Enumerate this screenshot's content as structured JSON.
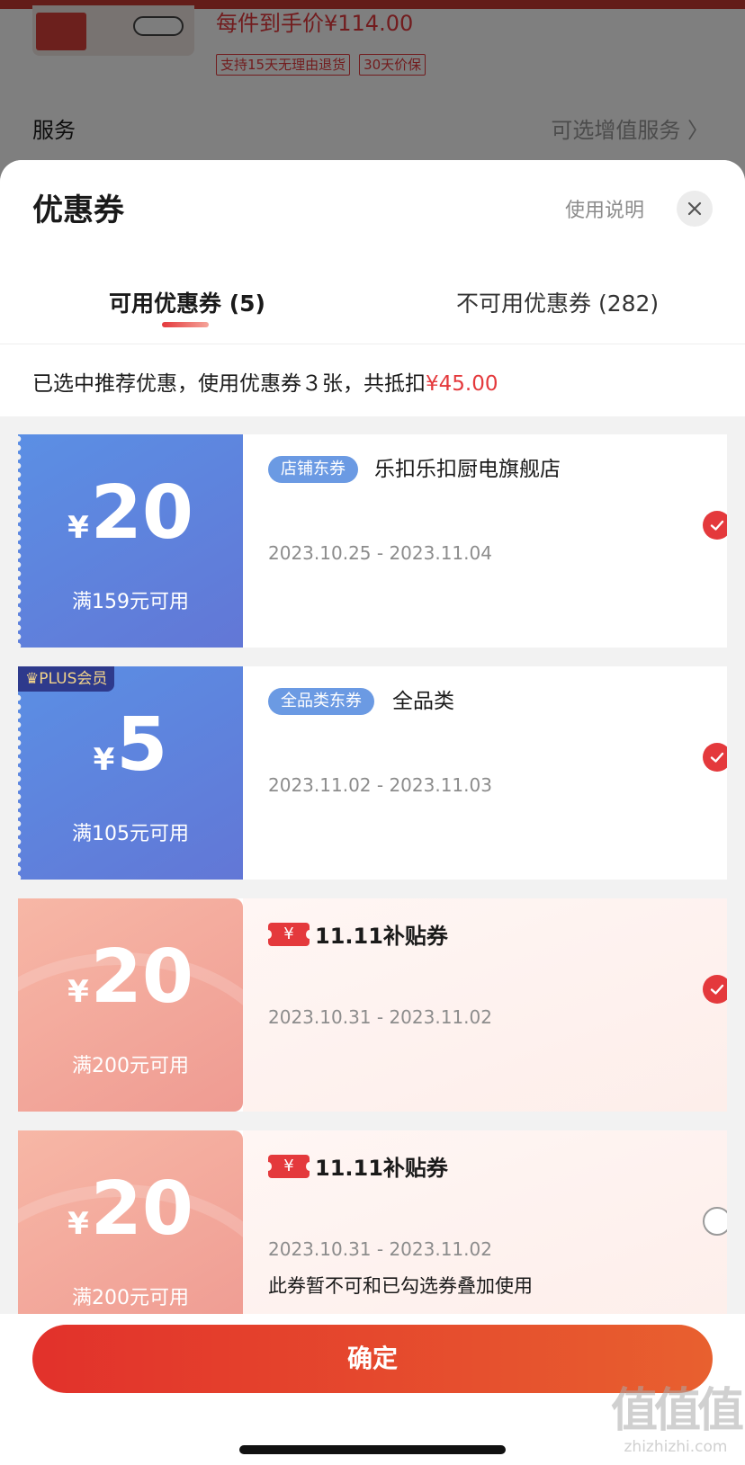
{
  "background": {
    "price_text": "每件到手价¥114.00",
    "tags": [
      "支持15天无理由退货",
      "30天价保"
    ],
    "service_label": "服务",
    "service_value": "可选增值服务 〉"
  },
  "sheet": {
    "title": "优惠券",
    "help_label": "使用说明",
    "close_icon": "close-icon"
  },
  "tabs": [
    {
      "label": "可用优惠券 (5)",
      "active": true
    },
    {
      "label": "不可用优惠券 (282)",
      "active": false
    }
  ],
  "summary": {
    "text": "已选中推荐优惠，使用优惠券３张，共抵扣",
    "amount": "¥45.00"
  },
  "coupons": [
    {
      "style": "blue",
      "currency": "¥",
      "amount": "20",
      "threshold": "满159元可用",
      "type_tag": "店铺东券",
      "scope": "乐扣乐扣厨电旗舰店",
      "validity": "2023.10.25 - 2023.11.04",
      "selected": true
    },
    {
      "style": "blue",
      "badge": "PLUS会员",
      "currency": "¥",
      "amount": "5",
      "threshold": "满105元可用",
      "type_tag": "全品类东券",
      "scope": "全品类",
      "validity": "2023.11.02 - 2023.11.03",
      "selected": true
    },
    {
      "style": "pink",
      "currency": "¥",
      "amount": "20",
      "threshold": "满200元可用",
      "subsidy_icon": "¥",
      "subsidy_label": "11.11补贴券",
      "validity": "2023.10.31 - 2023.11.02",
      "selected": true
    },
    {
      "style": "pink",
      "currency": "¥",
      "amount": "20",
      "threshold": "满200元可用",
      "subsidy_icon": "¥",
      "subsidy_label": "11.11补贴券",
      "validity": "2023.10.31 - 2023.11.02",
      "note": "此券暂不可和已勾选券叠加使用",
      "selected": false
    }
  ],
  "confirm_label": "确定",
  "watermark": {
    "mark": "值值值",
    "site": "zhizhizhi.com"
  },
  "colors": {
    "accent_red": "#e4393c",
    "coupon_blue": "#5b8fe4",
    "coupon_pink": "#f7b7a6"
  }
}
